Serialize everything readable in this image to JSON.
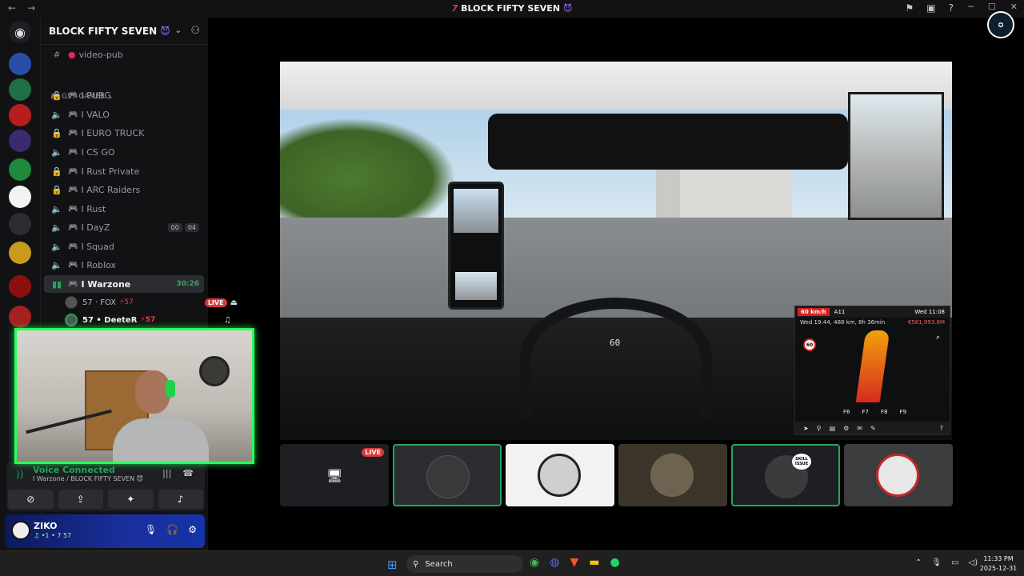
{
  "window": {
    "title": "BLOCK FIFTY SEVEN",
    "title_prefix_glyph": "7",
    "title_emoji": "😈"
  },
  "server": {
    "name": "BLOCK FIFTY SEVEN",
    "emoji": "😈",
    "channel_top": "video-pub",
    "category": "G57 GAMER",
    "channels": [
      {
        "label": "PUBG",
        "icon": "lock-icon"
      },
      {
        "label": "VALO",
        "icon": "speaker-lock-icon"
      },
      {
        "label": "EURO TRUCK",
        "icon": "lock-icon"
      },
      {
        "label": "CS GO",
        "icon": "speaker-lock-icon"
      },
      {
        "label": "Rust Private",
        "icon": "lock-icon"
      },
      {
        "label": "ARC Raiders",
        "icon": "lock-icon"
      },
      {
        "label": "Rust",
        "icon": "speaker-lock-icon"
      },
      {
        "label": "DayZ",
        "icon": "speaker-lock-icon"
      },
      {
        "label": "Squad",
        "icon": "speaker-lock-icon"
      },
      {
        "label": "Roblox",
        "icon": "speaker-lock-icon"
      },
      {
        "label": "Warzone",
        "icon": "voice-active-icon"
      }
    ],
    "channel_prefix": "I",
    "dayz_badges": [
      "00",
      "04"
    ],
    "warzone_time": "30:26",
    "voice_users": [
      {
        "name": "57 · FOX",
        "tag": "⚡57",
        "live": "LIVE"
      },
      {
        "name": "57 • DeeteR",
        "tag": "⚡57"
      }
    ]
  },
  "voice_panel": {
    "status": "Voice Connected",
    "location": "I Warzone / BLOCK FIFTY SEVEN 😈"
  },
  "user_panel": {
    "username": "ZIKO",
    "status": "♫ •1 • 7 57"
  },
  "gps": {
    "speed": "60 km/h",
    "road": "A11",
    "time": "Wed 11:08",
    "eta": "Wed 19:44, 488 km, 8h 36min",
    "money": "€581,993.8M",
    "speed_limit": "60",
    "fkeys": [
      "F6",
      "F7",
      "F8",
      "F9"
    ]
  },
  "dashboard": {
    "speedo": "60"
  },
  "tiles": [
    {
      "live": "LIVE"
    },
    {},
    {},
    {},
    {
      "badge": "SKILL ISSUE"
    },
    {}
  ],
  "taskbar": {
    "search_label": "Search",
    "time": "11:33 PM",
    "date": "2025-12-31"
  },
  "colors": {
    "accent_green": "#23a55a",
    "live_red": "#da373c",
    "user_panel_blue": "#1a2f9c",
    "webcam_border": "#2bff5a"
  }
}
